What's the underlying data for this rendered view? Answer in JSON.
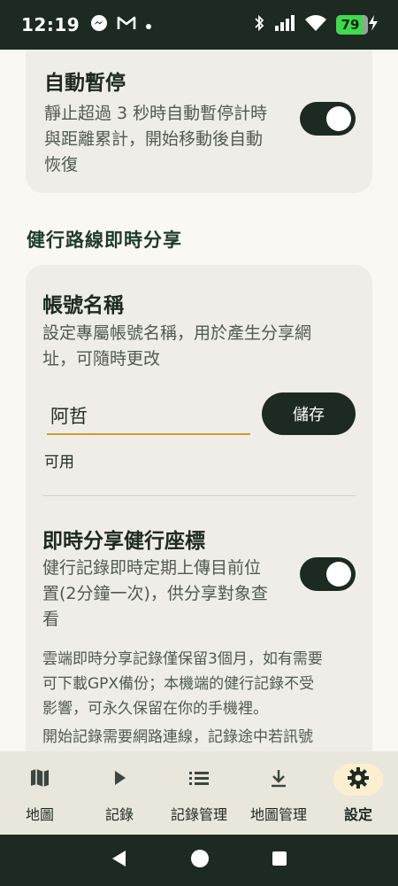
{
  "status_bar": {
    "time": "12:19",
    "battery": "79",
    "icons": [
      "messenger-icon",
      "gmail-icon",
      "dot-icon",
      "bluetooth-icon",
      "signal-icon",
      "wifi-icon",
      "charging-icon"
    ]
  },
  "auto_pause": {
    "title": "自動暫停",
    "desc_line1": "靜止超過 3 秒時自動暫停計時",
    "desc_line2": "與距離累計，開始移動後自動",
    "desc_line3": "恢復",
    "enabled": true
  },
  "section": {
    "heading": "健行路線即時分享"
  },
  "account": {
    "title": "帳號名稱",
    "desc_line1": "設定專屬帳號名稱，用於產生分享網",
    "desc_line2": "址，可隨時更改",
    "input_value": "阿哲",
    "save_label": "儲存",
    "status": "可用"
  },
  "live_share": {
    "title": "即時分享健行座標",
    "desc_line1": "健行記錄即時定期上傳目前位",
    "desc_line2": "置(2分鐘一次)，供分享對象查",
    "desc_line3": "看",
    "enabled": true,
    "note1_line1": "雲端即時分享記錄僅保留3個月，如有需要",
    "note1_line2": "可下載GPX備份；本機端的健行記錄不受",
    "note1_line3": "影響，可永久保留在你的手機裡。",
    "note2_line1": "開始記錄需要網路連線，記錄途中若訊號"
  },
  "bottom_nav": {
    "items": [
      {
        "label": "地圖",
        "icon": "map-icon"
      },
      {
        "label": "記錄",
        "icon": "play-icon"
      },
      {
        "label": "記錄管理",
        "icon": "list-icon"
      },
      {
        "label": "地圖管理",
        "icon": "download-icon"
      },
      {
        "label": "設定",
        "icon": "gear-icon",
        "active": true
      }
    ]
  },
  "colors": {
    "primary": "#1c2a22",
    "background": "#faf8f3",
    "card": "#efede8",
    "accent": "#d49a2e",
    "active_nav": "#fcefcf"
  }
}
